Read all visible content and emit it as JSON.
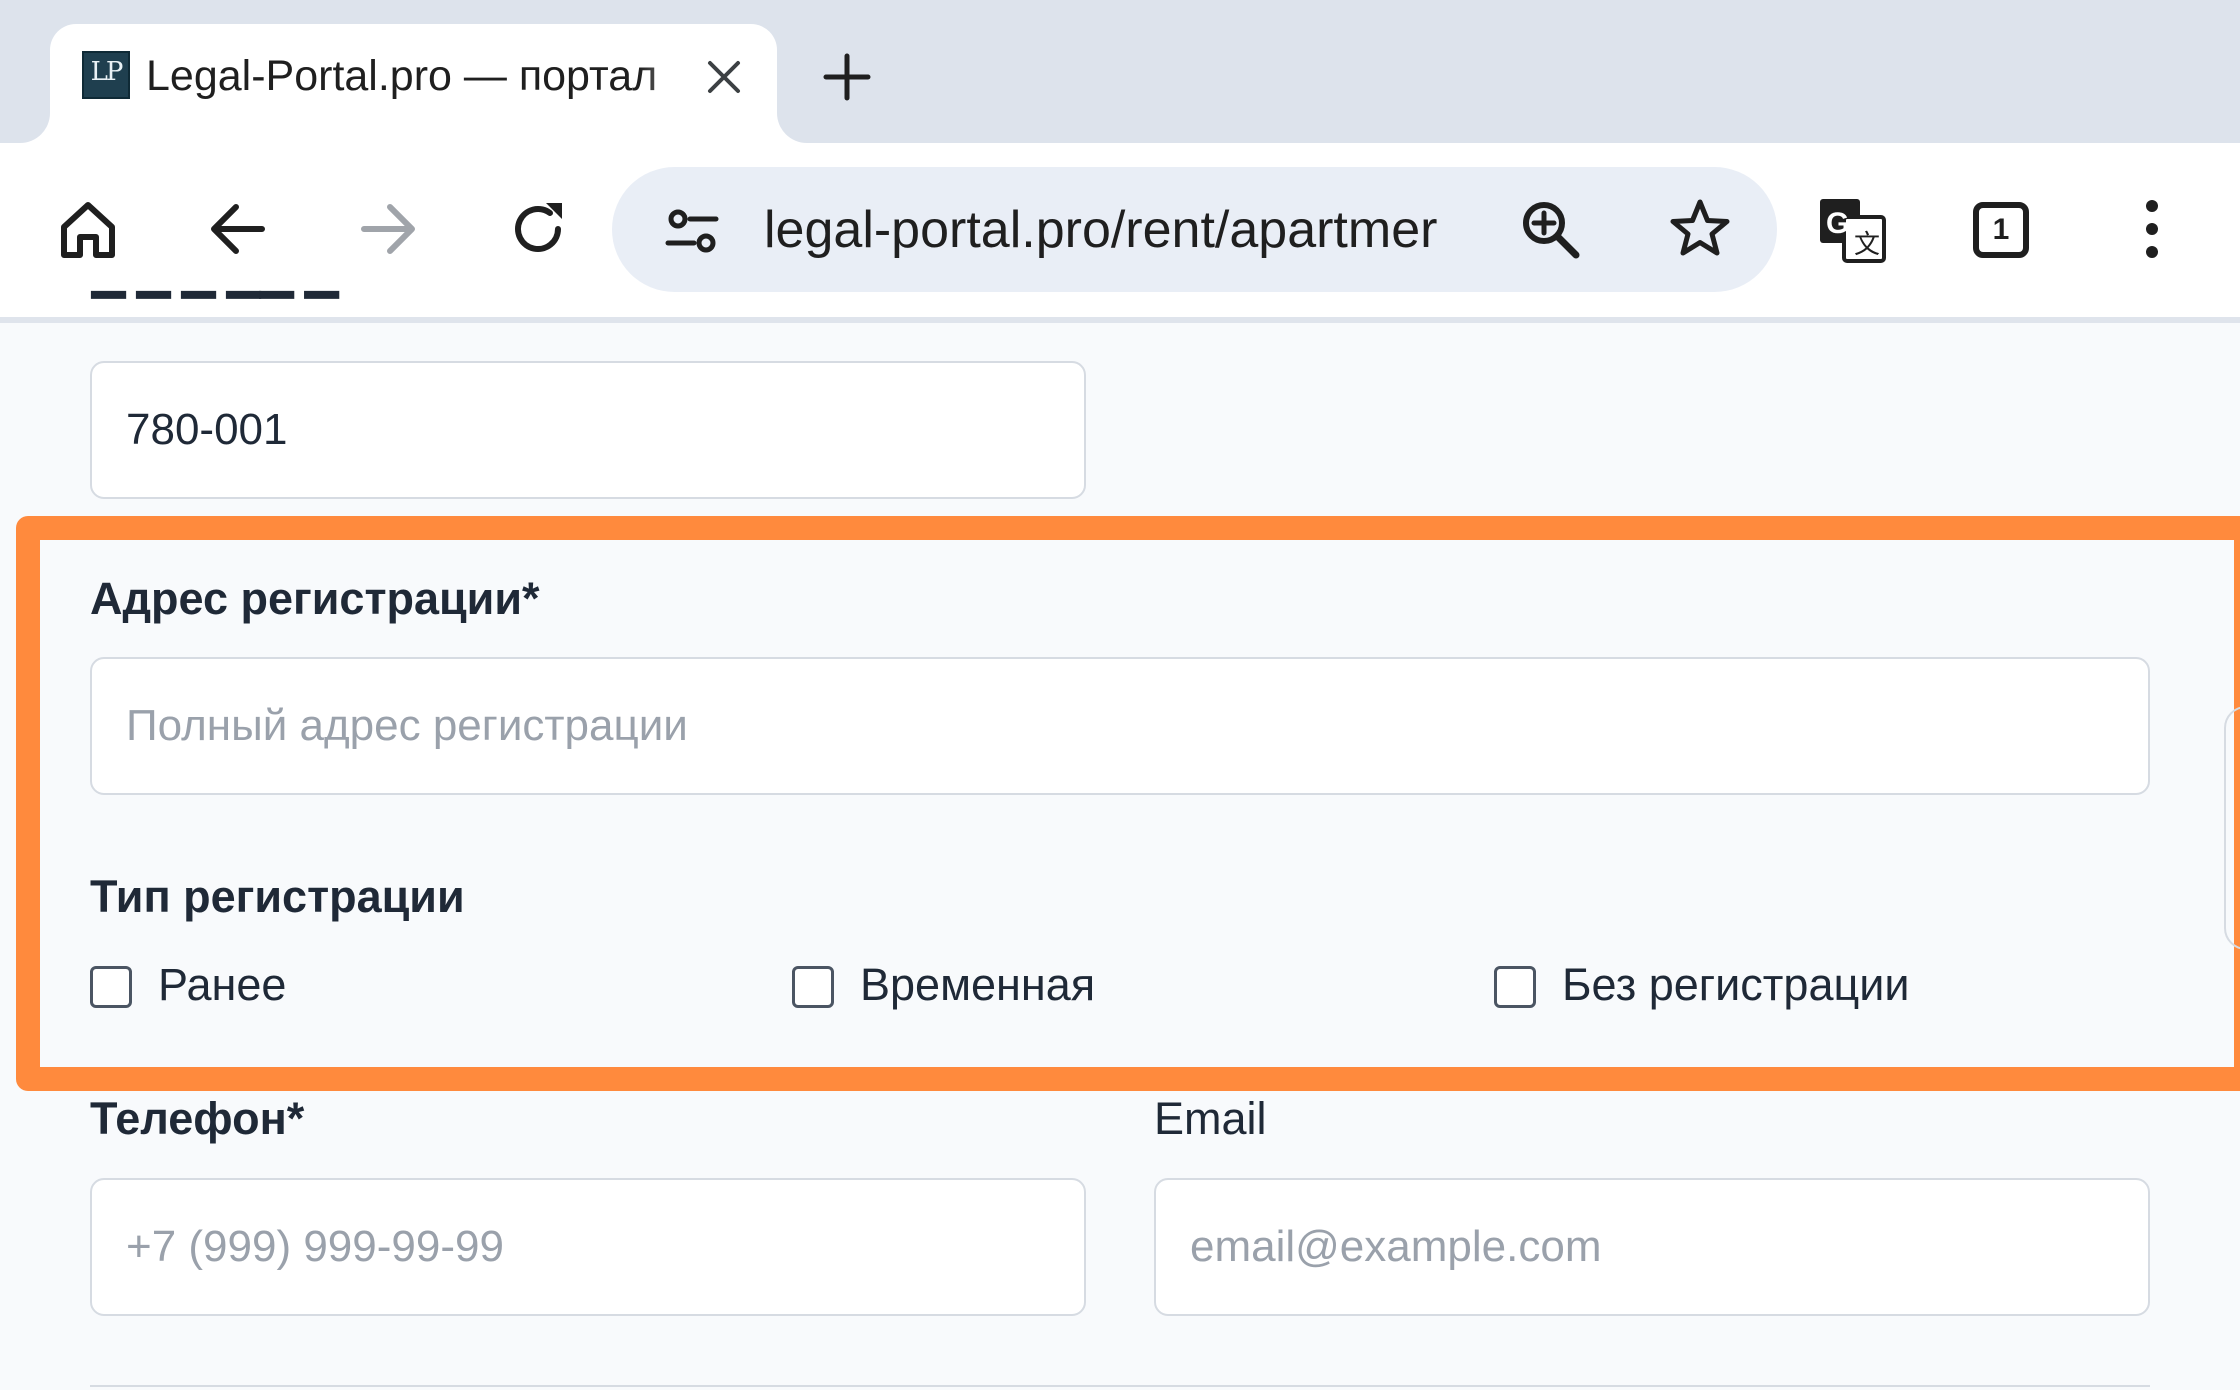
{
  "browser": {
    "tab": {
      "favicon_text": "LP",
      "title": "Legal-Portal.pro — портал"
    },
    "omnibox": {
      "url": "legal-portal.pro/rent/apartmer"
    },
    "tab_count": "1"
  },
  "form": {
    "previous_field": {
      "value": "780-001"
    },
    "registration_address": {
      "label": "Адрес регистрации*",
      "placeholder": "Полный адрес регистрации"
    },
    "registration_type": {
      "label": "Тип регистрации",
      "options": [
        {
          "label": "Ранее",
          "checked": false
        },
        {
          "label": "Временная",
          "checked": false
        },
        {
          "label": "Без регистрации",
          "checked": false
        }
      ]
    },
    "phone": {
      "label": "Телефон*",
      "placeholder": "+7 (999) 999-99-99"
    },
    "email": {
      "label": "Email",
      "placeholder": "email@example.com"
    }
  },
  "colors": {
    "highlight": "#ff8a3d",
    "page_background": "#f8fafc",
    "tabstrip_background": "#dde3ec",
    "omnibox_background": "#e9eef6"
  }
}
